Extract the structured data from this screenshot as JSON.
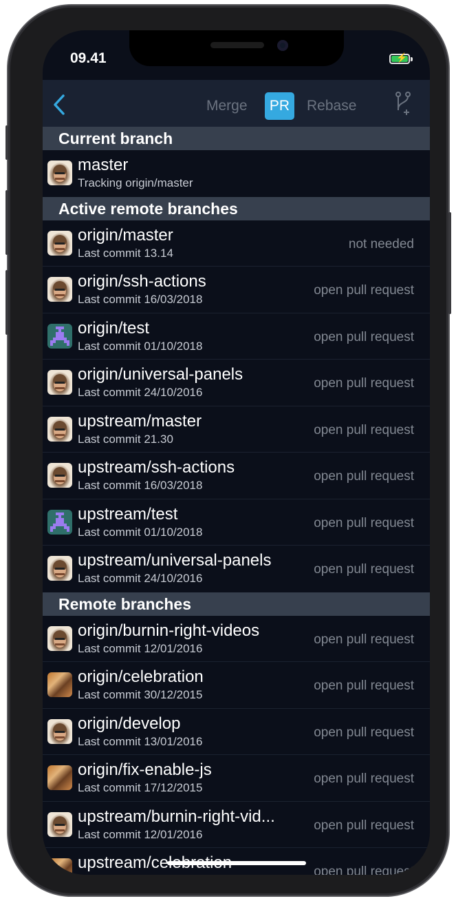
{
  "status_bar": {
    "time": "09.41"
  },
  "navbar": {
    "segments": {
      "merge": "Merge",
      "pr": "PR",
      "rebase": "Rebase"
    },
    "accent_color": "#35a9e0"
  },
  "sections": {
    "current": {
      "title": "Current branch",
      "rows": [
        {
          "name": "master",
          "subtitle": "Tracking origin/master",
          "action": "",
          "avatar": "face"
        }
      ]
    },
    "active_remote": {
      "title": "Active remote branches",
      "rows": [
        {
          "name": "origin/master",
          "subtitle": "Last commit 13.14",
          "action": "not needed",
          "avatar": "face"
        },
        {
          "name": "origin/ssh-actions",
          "subtitle": "Last commit 16/03/2018",
          "action": "open pull request",
          "avatar": "face"
        },
        {
          "name": "origin/test",
          "subtitle": "Last commit 01/10/2018",
          "action": "open pull request",
          "avatar": "pixel"
        },
        {
          "name": "origin/universal-panels",
          "subtitle": "Last commit 24/10/2016",
          "action": "open pull request",
          "avatar": "face"
        },
        {
          "name": "upstream/master",
          "subtitle": "Last commit 21.30",
          "action": "open pull request",
          "avatar": "face"
        },
        {
          "name": "upstream/ssh-actions",
          "subtitle": "Last commit 16/03/2018",
          "action": "open pull request",
          "avatar": "face"
        },
        {
          "name": "upstream/test",
          "subtitle": "Last commit 01/10/2018",
          "action": "open pull request",
          "avatar": "pixel"
        },
        {
          "name": "upstream/universal-panels",
          "subtitle": "Last commit 24/10/2016",
          "action": "open pull request",
          "avatar": "face"
        }
      ]
    },
    "remote": {
      "title": "Remote branches",
      "rows": [
        {
          "name": "origin/burnin-right-videos",
          "subtitle": "Last commit 12/01/2016",
          "action": "open pull request",
          "avatar": "face"
        },
        {
          "name": "origin/celebration",
          "subtitle": "Last commit 30/12/2015",
          "action": "open pull request",
          "avatar": "photo"
        },
        {
          "name": "origin/develop",
          "subtitle": "Last commit 13/01/2016",
          "action": "open pull request",
          "avatar": "face"
        },
        {
          "name": "origin/fix-enable-js",
          "subtitle": "Last commit 17/12/2015",
          "action": "open pull request",
          "avatar": "photo"
        },
        {
          "name": "upstream/burnin-right-vid...",
          "subtitle": "Last commit 12/01/2016",
          "action": "open pull request",
          "avatar": "face"
        },
        {
          "name": "upstream/celebration",
          "subtitle": "",
          "action": "open pull request",
          "avatar": "photo"
        }
      ]
    }
  }
}
